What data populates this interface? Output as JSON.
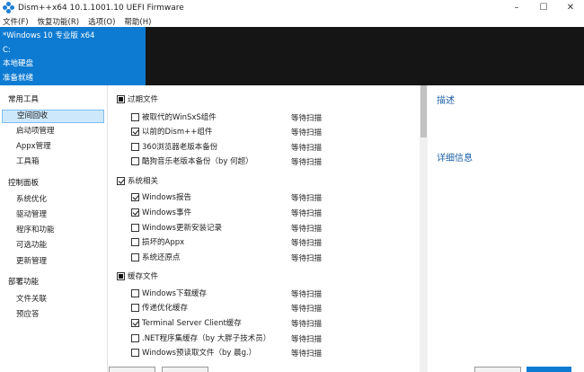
{
  "window": {
    "title": "Dism++x64 10.1.1001.10 UEFI Firmware",
    "minimize": "–",
    "maximize": "☐",
    "close": "✕"
  },
  "menu": [
    "文件(F)",
    "恢复功能(R)",
    "选项(O)",
    "帮助(H)"
  ],
  "header": {
    "os_name": "*Windows 10 专业版 x64",
    "drive": "C:",
    "disk_type": "本地硬盘",
    "status": "准备就绪"
  },
  "sidebar": {
    "groups": [
      {
        "label": "常用工具",
        "items": [
          "空间回收",
          "启动项管理",
          "Appx管理",
          "工具箱"
        ]
      },
      {
        "label": "控制面板",
        "items": [
          "系统优化",
          "驱动管理",
          "程序和功能",
          "可选功能",
          "更新管理"
        ]
      },
      {
        "label": "部署功能",
        "items": [
          "文件关联",
          "预应答"
        ]
      }
    ],
    "active": "空间回收"
  },
  "list": {
    "sections": [
      {
        "title": "过期文件",
        "state": "partial",
        "items": [
          {
            "label": "被取代的WinSxS组件",
            "checked": false,
            "status": "等待扫描"
          },
          {
            "label": "以前的Dism++组件",
            "checked": true,
            "status": "等待扫描"
          },
          {
            "label": "360浏览器老版本备份",
            "checked": false,
            "status": "等待扫描"
          },
          {
            "label": "酷狗音乐老版本备份（by 何超）",
            "checked": false,
            "status": "等待扫描"
          }
        ]
      },
      {
        "title": "系统相关",
        "state": "checked",
        "items": [
          {
            "label": "Windows报告",
            "checked": true,
            "status": "等待扫描"
          },
          {
            "label": "Windows事件",
            "checked": true,
            "status": "等待扫描"
          },
          {
            "label": "Windows更新安装记录",
            "checked": false,
            "status": "等待扫描"
          },
          {
            "label": "损坏的Appx",
            "checked": false,
            "status": "等待扫描"
          },
          {
            "label": "系统还原点",
            "checked": false,
            "status": "等待扫描"
          }
        ]
      },
      {
        "title": "缓存文件",
        "state": "partial",
        "items": [
          {
            "label": "Windows下载缓存",
            "checked": false,
            "status": "等待扫描"
          },
          {
            "label": "传递优化缓存",
            "checked": false,
            "status": "等待扫描"
          },
          {
            "label": "Terminal Server Client缓存",
            "checked": true,
            "status": "等待扫描"
          },
          {
            "label": ".NET程序集缓存（by 大胖子技术员）",
            "checked": false,
            "status": "等待扫描"
          },
          {
            "label": "Windows预读取文件（by 晨g.）",
            "checked": false,
            "status": "等待扫描"
          }
        ]
      }
    ]
  },
  "details": {
    "description_title": "描述",
    "details_title": "详细信息"
  },
  "colors": {
    "accent": "#0e7bd2",
    "header_bg": "#151515",
    "selection_bg": "#cde8fb",
    "link": "#1c5fa6"
  }
}
